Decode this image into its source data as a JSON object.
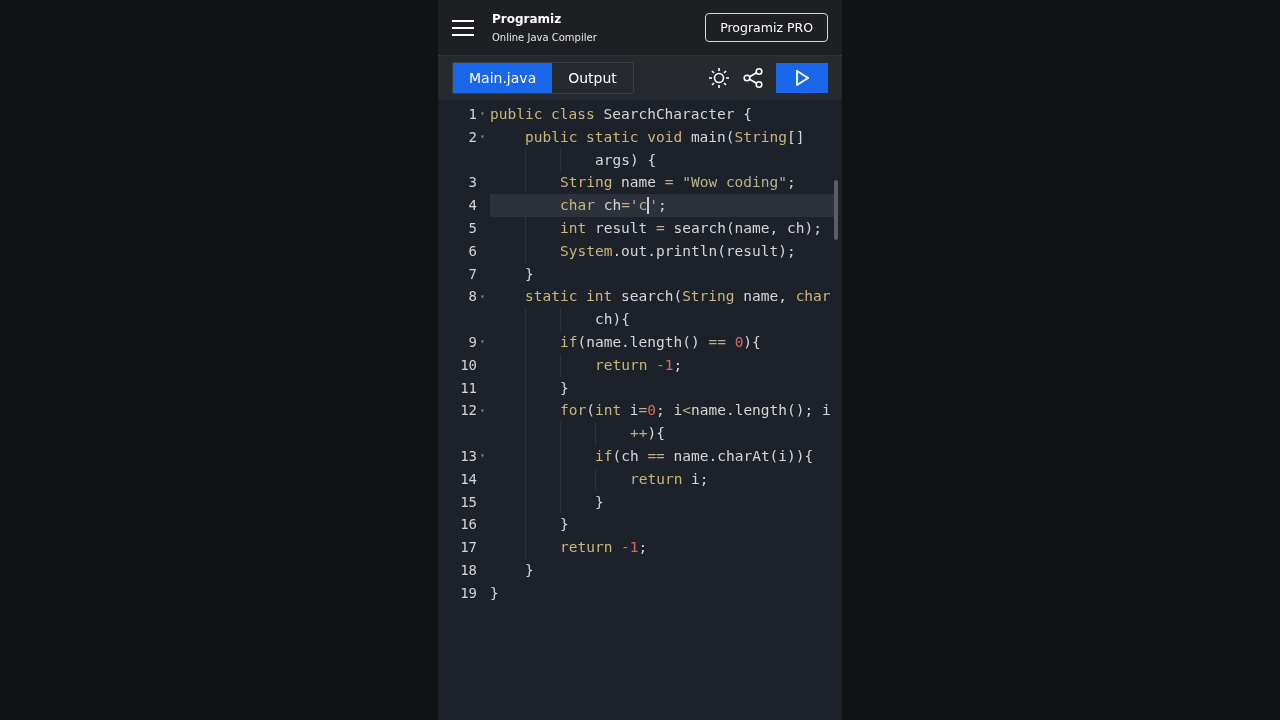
{
  "header": {
    "logo": "Programiz",
    "subtitle": "Online Java Compiler",
    "pro_button": "Programiz PRO"
  },
  "tabs": [
    {
      "label": "Main.java",
      "selected": true
    },
    {
      "label": "Output",
      "selected": false
    }
  ],
  "code": [
    {
      "number": "1",
      "fold_marker": "▾",
      "active": false,
      "tokens": [
        {
          "kind": "kw",
          "t": "public class "
        },
        {
          "kind": "plain",
          "t": "SearchCharacter {"
        }
      ],
      "children": [
        {
          "number": "2",
          "fold_marker": "▾",
          "active": false,
          "tokens": [
            {
              "kind": "kw",
              "t": "public static void "
            },
            {
              "kind": "plain",
              "t": "main("
            },
            {
              "kind": "kw",
              "t": "String"
            },
            {
              "kind": "plain",
              "t": "[]"
            }
          ],
          "wrap": [
            {
              "kind": "plain",
              "t": "args) {"
            }
          ],
          "children": [
            {
              "number": "3",
              "active": false,
              "tokens": [
                {
                  "kind": "kw",
                  "t": "String "
                },
                {
                  "kind": "plain",
                  "t": "name "
                },
                {
                  "kind": "op",
                  "t": "= "
                },
                {
                  "kind": "str",
                  "t": "\"Wow coding\""
                },
                {
                  "kind": "plain",
                  "t": ";"
                }
              ]
            },
            {
              "number": "4",
              "active": true,
              "tokens": [
                {
                  "kind": "kw",
                  "t": "char "
                },
                {
                  "kind": "plain",
                  "t": "ch"
                },
                {
                  "kind": "op",
                  "t": "="
                },
                {
                  "kind": "str",
                  "t": "'c"
                },
                {
                  "kind": "cursor"
                },
                {
                  "kind": "str",
                  "t": "'"
                },
                {
                  "kind": "plain",
                  "t": ";"
                }
              ]
            },
            {
              "number": "5",
              "active": false,
              "tokens": [
                {
                  "kind": "kw",
                  "t": "int "
                },
                {
                  "kind": "plain",
                  "t": "result "
                },
                {
                  "kind": "op",
                  "t": "= "
                },
                {
                  "kind": "plain",
                  "t": "search(name, ch);"
                }
              ]
            },
            {
              "number": "6",
              "active": false,
              "tokens": [
                {
                  "kind": "kw",
                  "t": "System"
                },
                {
                  "kind": "plain",
                  "t": ".out.println(result);"
                }
              ]
            }
          ]
        },
        {
          "number": "7",
          "active": false,
          "tokens": [
            {
              "kind": "plain",
              "t": "}"
            }
          ]
        },
        {
          "number": "8",
          "fold_marker": "▾",
          "active": false,
          "tokens": [
            {
              "kind": "kw",
              "t": "static int "
            },
            {
              "kind": "plain",
              "t": "search("
            },
            {
              "kind": "kw",
              "t": "String "
            },
            {
              "kind": "plain",
              "t": "name, "
            },
            {
              "kind": "kw",
              "t": "char"
            }
          ],
          "wrap": [
            {
              "kind": "plain",
              "t": "ch){"
            }
          ],
          "children": [
            {
              "number": "9",
              "fold_marker": "▾",
              "active": false,
              "tokens": [
                {
                  "kind": "kw",
                  "t": "if"
                },
                {
                  "kind": "plain",
                  "t": "(name.length() "
                },
                {
                  "kind": "op",
                  "t": "== "
                },
                {
                  "kind": "num",
                  "t": "0"
                },
                {
                  "kind": "plain",
                  "t": "){"
                }
              ],
              "children": [
                {
                  "number": "10",
                  "active": false,
                  "tokens": [
                    {
                      "kind": "kw",
                      "t": "return "
                    },
                    {
                      "kind": "num",
                      "t": "-1"
                    },
                    {
                      "kind": "plain",
                      "t": ";"
                    }
                  ]
                }
              ]
            },
            {
              "number": "11",
              "active": false,
              "tokens": [
                {
                  "kind": "plain",
                  "t": "}"
                }
              ]
            },
            {
              "number": "12",
              "fold_marker": "▾",
              "active": false,
              "tokens": [
                {
                  "kind": "kw",
                  "t": "for"
                },
                {
                  "kind": "plain",
                  "t": "("
                },
                {
                  "kind": "kw",
                  "t": "int "
                },
                {
                  "kind": "plain",
                  "t": "i"
                },
                {
                  "kind": "op",
                  "t": "="
                },
                {
                  "kind": "num",
                  "t": "0"
                },
                {
                  "kind": "plain",
                  "t": "; i"
                },
                {
                  "kind": "op",
                  "t": "<"
                },
                {
                  "kind": "plain",
                  "t": "name.length(); i"
                }
              ],
              "wrap": [
                {
                  "kind": "op",
                  "t": "++"
                },
                {
                  "kind": "plain",
                  "t": "){"
                }
              ],
              "children": [
                {
                  "number": "13",
                  "fold_marker": "▾",
                  "active": false,
                  "tokens": [
                    {
                      "kind": "kw",
                      "t": "if"
                    },
                    {
                      "kind": "plain",
                      "t": "(ch "
                    },
                    {
                      "kind": "op",
                      "t": "== "
                    },
                    {
                      "kind": "plain",
                      "t": "name.charAt(i)){"
                    }
                  ],
                  "children": [
                    {
                      "number": "14",
                      "active": false,
                      "tokens": [
                        {
                          "kind": "kw",
                          "t": "return "
                        },
                        {
                          "kind": "plain",
                          "t": "i;"
                        }
                      ]
                    }
                  ]
                },
                {
                  "number": "15",
                  "active": false,
                  "tokens": [
                    {
                      "kind": "plain",
                      "t": "}"
                    }
                  ]
                }
              ]
            },
            {
              "number": "16",
              "active": false,
              "tokens": [
                {
                  "kind": "plain",
                  "t": "}"
                }
              ]
            },
            {
              "number": "17",
              "active": false,
              "tokens": [
                {
                  "kind": "kw",
                  "t": "return "
                },
                {
                  "kind": "num",
                  "t": "-1"
                },
                {
                  "kind": "plain",
                  "t": ";"
                }
              ]
            }
          ]
        },
        {
          "number": "18",
          "active": false,
          "tokens": [
            {
              "kind": "plain",
              "t": "}"
            }
          ]
        }
      ]
    },
    {
      "number": "19",
      "active": false,
      "tokens": [
        {
          "kind": "plain",
          "t": "}"
        }
      ]
    }
  ]
}
